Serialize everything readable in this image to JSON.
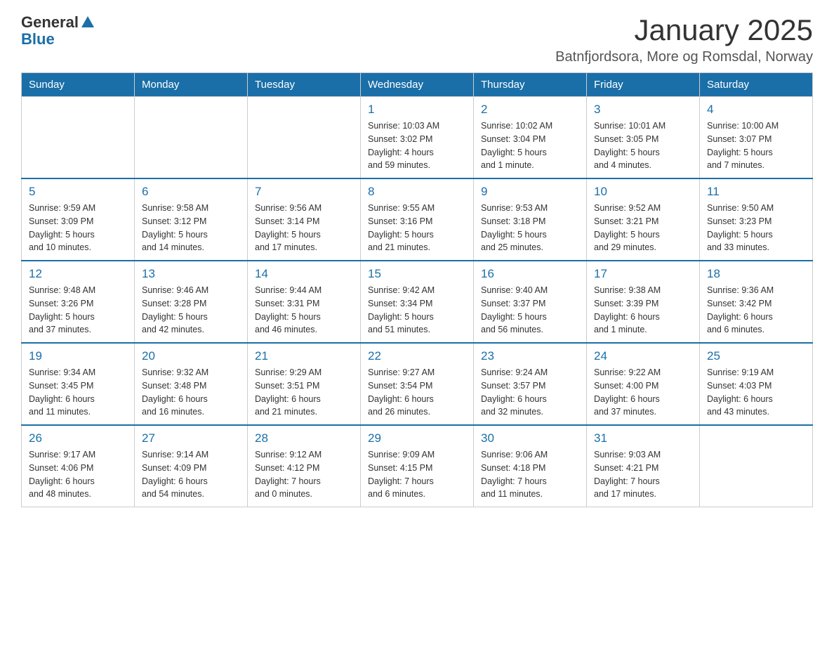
{
  "logo": {
    "general": "General",
    "blue": "Blue"
  },
  "header": {
    "month": "January 2025",
    "location": "Batnfjordsora, More og Romsdal, Norway"
  },
  "days": [
    "Sunday",
    "Monday",
    "Tuesday",
    "Wednesday",
    "Thursday",
    "Friday",
    "Saturday"
  ],
  "weeks": [
    [
      {
        "day": "",
        "info": ""
      },
      {
        "day": "",
        "info": ""
      },
      {
        "day": "",
        "info": ""
      },
      {
        "day": "1",
        "info": "Sunrise: 10:03 AM\nSunset: 3:02 PM\nDaylight: 4 hours\nand 59 minutes."
      },
      {
        "day": "2",
        "info": "Sunrise: 10:02 AM\nSunset: 3:04 PM\nDaylight: 5 hours\nand 1 minute."
      },
      {
        "day": "3",
        "info": "Sunrise: 10:01 AM\nSunset: 3:05 PM\nDaylight: 5 hours\nand 4 minutes."
      },
      {
        "day": "4",
        "info": "Sunrise: 10:00 AM\nSunset: 3:07 PM\nDaylight: 5 hours\nand 7 minutes."
      }
    ],
    [
      {
        "day": "5",
        "info": "Sunrise: 9:59 AM\nSunset: 3:09 PM\nDaylight: 5 hours\nand 10 minutes."
      },
      {
        "day": "6",
        "info": "Sunrise: 9:58 AM\nSunset: 3:12 PM\nDaylight: 5 hours\nand 14 minutes."
      },
      {
        "day": "7",
        "info": "Sunrise: 9:56 AM\nSunset: 3:14 PM\nDaylight: 5 hours\nand 17 minutes."
      },
      {
        "day": "8",
        "info": "Sunrise: 9:55 AM\nSunset: 3:16 PM\nDaylight: 5 hours\nand 21 minutes."
      },
      {
        "day": "9",
        "info": "Sunrise: 9:53 AM\nSunset: 3:18 PM\nDaylight: 5 hours\nand 25 minutes."
      },
      {
        "day": "10",
        "info": "Sunrise: 9:52 AM\nSunset: 3:21 PM\nDaylight: 5 hours\nand 29 minutes."
      },
      {
        "day": "11",
        "info": "Sunrise: 9:50 AM\nSunset: 3:23 PM\nDaylight: 5 hours\nand 33 minutes."
      }
    ],
    [
      {
        "day": "12",
        "info": "Sunrise: 9:48 AM\nSunset: 3:26 PM\nDaylight: 5 hours\nand 37 minutes."
      },
      {
        "day": "13",
        "info": "Sunrise: 9:46 AM\nSunset: 3:28 PM\nDaylight: 5 hours\nand 42 minutes."
      },
      {
        "day": "14",
        "info": "Sunrise: 9:44 AM\nSunset: 3:31 PM\nDaylight: 5 hours\nand 46 minutes."
      },
      {
        "day": "15",
        "info": "Sunrise: 9:42 AM\nSunset: 3:34 PM\nDaylight: 5 hours\nand 51 minutes."
      },
      {
        "day": "16",
        "info": "Sunrise: 9:40 AM\nSunset: 3:37 PM\nDaylight: 5 hours\nand 56 minutes."
      },
      {
        "day": "17",
        "info": "Sunrise: 9:38 AM\nSunset: 3:39 PM\nDaylight: 6 hours\nand 1 minute."
      },
      {
        "day": "18",
        "info": "Sunrise: 9:36 AM\nSunset: 3:42 PM\nDaylight: 6 hours\nand 6 minutes."
      }
    ],
    [
      {
        "day": "19",
        "info": "Sunrise: 9:34 AM\nSunset: 3:45 PM\nDaylight: 6 hours\nand 11 minutes."
      },
      {
        "day": "20",
        "info": "Sunrise: 9:32 AM\nSunset: 3:48 PM\nDaylight: 6 hours\nand 16 minutes."
      },
      {
        "day": "21",
        "info": "Sunrise: 9:29 AM\nSunset: 3:51 PM\nDaylight: 6 hours\nand 21 minutes."
      },
      {
        "day": "22",
        "info": "Sunrise: 9:27 AM\nSunset: 3:54 PM\nDaylight: 6 hours\nand 26 minutes."
      },
      {
        "day": "23",
        "info": "Sunrise: 9:24 AM\nSunset: 3:57 PM\nDaylight: 6 hours\nand 32 minutes."
      },
      {
        "day": "24",
        "info": "Sunrise: 9:22 AM\nSunset: 4:00 PM\nDaylight: 6 hours\nand 37 minutes."
      },
      {
        "day": "25",
        "info": "Sunrise: 9:19 AM\nSunset: 4:03 PM\nDaylight: 6 hours\nand 43 minutes."
      }
    ],
    [
      {
        "day": "26",
        "info": "Sunrise: 9:17 AM\nSunset: 4:06 PM\nDaylight: 6 hours\nand 48 minutes."
      },
      {
        "day": "27",
        "info": "Sunrise: 9:14 AM\nSunset: 4:09 PM\nDaylight: 6 hours\nand 54 minutes."
      },
      {
        "day": "28",
        "info": "Sunrise: 9:12 AM\nSunset: 4:12 PM\nDaylight: 7 hours\nand 0 minutes."
      },
      {
        "day": "29",
        "info": "Sunrise: 9:09 AM\nSunset: 4:15 PM\nDaylight: 7 hours\nand 6 minutes."
      },
      {
        "day": "30",
        "info": "Sunrise: 9:06 AM\nSunset: 4:18 PM\nDaylight: 7 hours\nand 11 minutes."
      },
      {
        "day": "31",
        "info": "Sunrise: 9:03 AM\nSunset: 4:21 PM\nDaylight: 7 hours\nand 17 minutes."
      },
      {
        "day": "",
        "info": ""
      }
    ]
  ]
}
